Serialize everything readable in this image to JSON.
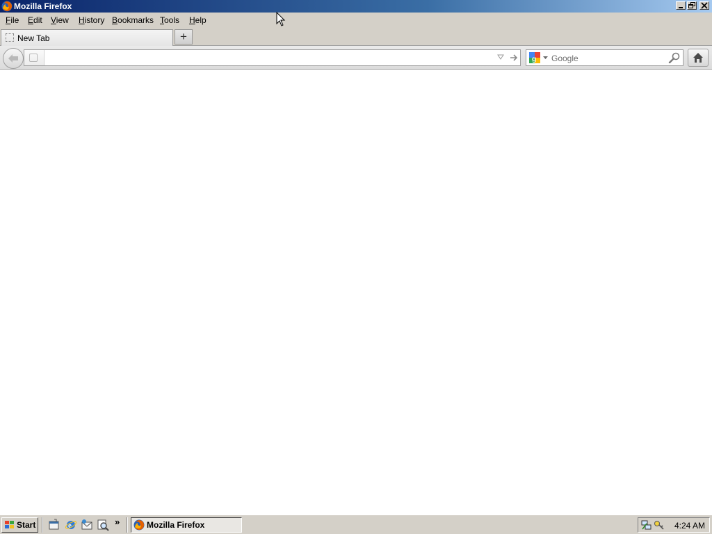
{
  "window": {
    "title": "Mozilla Firefox"
  },
  "menubar": {
    "items": [
      {
        "label": "File",
        "mnemonic": "F",
        "rest": "ile"
      },
      {
        "label": "Edit",
        "mnemonic": "E",
        "rest": "dit"
      },
      {
        "label": "View",
        "mnemonic": "V",
        "rest": "iew"
      },
      {
        "label": "History",
        "mnemonic": "H",
        "rest": "istory"
      },
      {
        "label": "Bookmarks",
        "mnemonic": "B",
        "rest": "ookmarks"
      },
      {
        "label": "Tools",
        "mnemonic": "T",
        "rest": "ools"
      },
      {
        "label": "Help",
        "mnemonic": "H",
        "rest": "elp"
      }
    ]
  },
  "tabs": [
    {
      "label": "New Tab"
    }
  ],
  "newtab": {
    "label": "+"
  },
  "navbar": {
    "url_value": "",
    "search_placeholder": "Google"
  },
  "taskbar": {
    "start_label": "Start",
    "overflow": "»",
    "task_label": "Mozilla Firefox",
    "clock": "4:24 AM"
  },
  "colors": {
    "titlebar_start": "#0a246a",
    "titlebar_end": "#a6caf0",
    "chrome_gray": "#d4d0c8",
    "content": "#ffffff"
  }
}
